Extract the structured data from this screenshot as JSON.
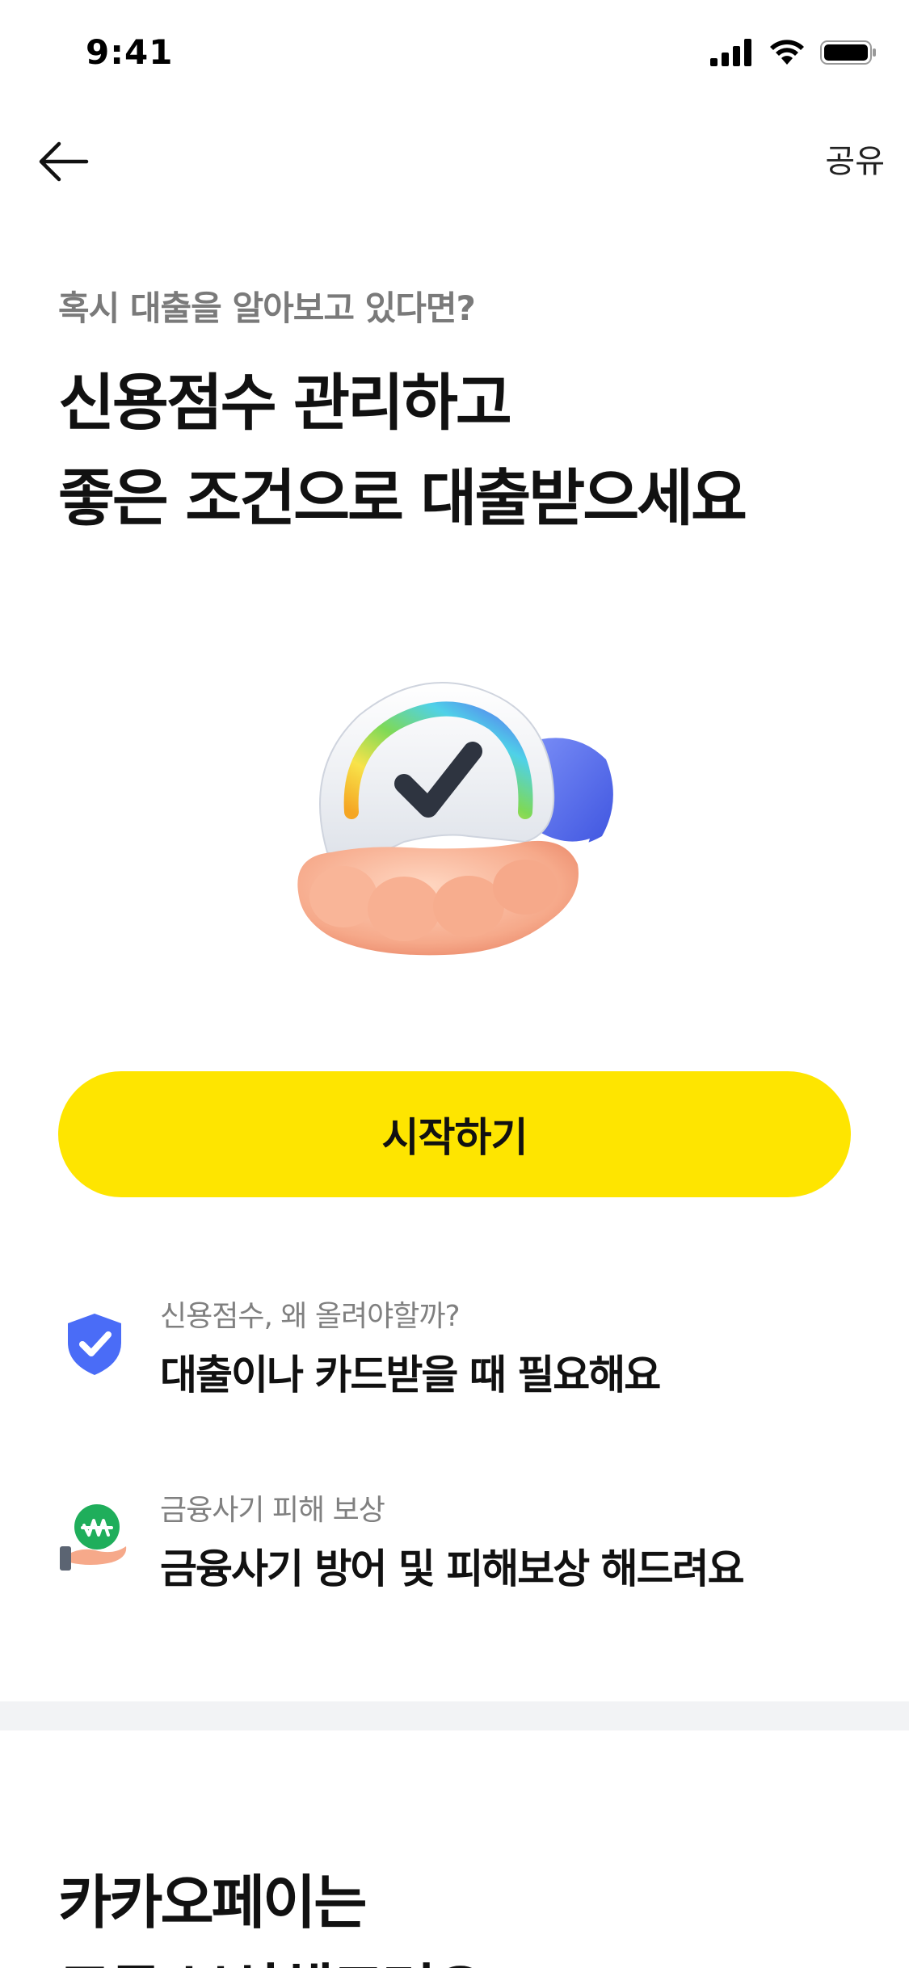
{
  "status_bar": {
    "time": "9:41"
  },
  "nav": {
    "share_label": "공유"
  },
  "hero": {
    "subtitle": "혹시 대출을 알아보고 있다면?",
    "title_line1": "신용점수 관리하고",
    "title_line2": "좋은 조건으로 대출받으세요"
  },
  "cta": {
    "start_label": "시작하기"
  },
  "features": [
    {
      "label": "신용점수, 왜 올려야할까?",
      "text": "대출이나 카드받을 때 필요해요",
      "icon": "shield-check-icon"
    },
    {
      "label": "금융사기 피해 보상",
      "text": "금융사기 방어 및 피해보상 해드려요",
      "icon": "hand-won-coin-icon"
    }
  ],
  "bottom": {
    "title_line1": "카카오페이는",
    "title_line2": "모두 보상해드려요"
  },
  "colors": {
    "accent": "#fee500",
    "shield": "#4a6cf7",
    "coin": "#1fae5b",
    "divider": "#f2f3f5"
  }
}
